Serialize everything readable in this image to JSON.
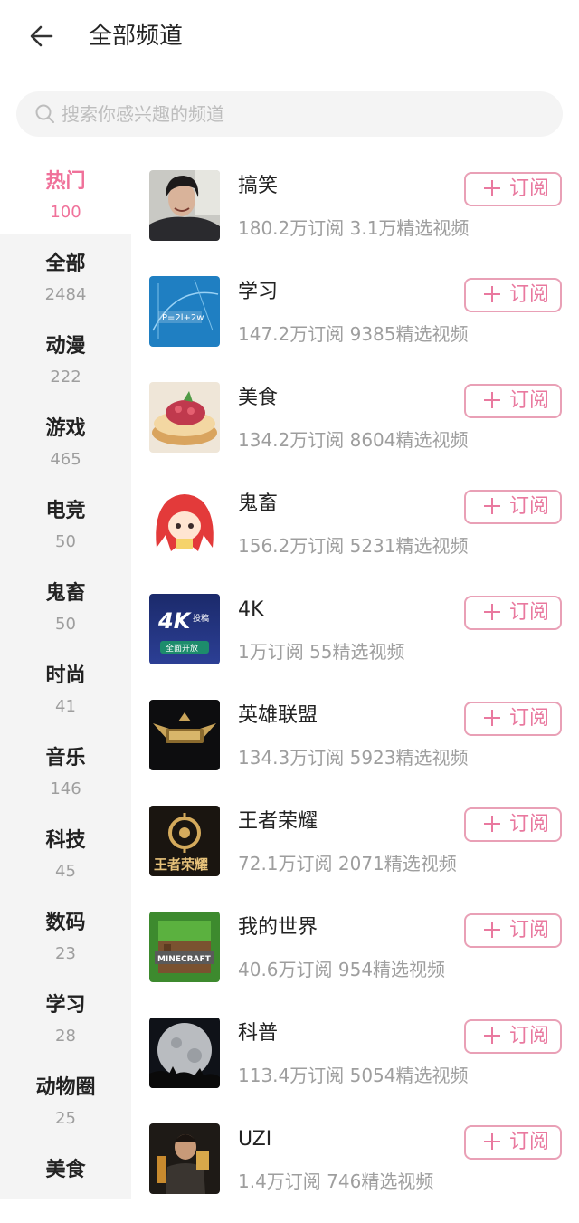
{
  "header": {
    "title": "全部频道"
  },
  "search": {
    "placeholder": "搜索你感兴趣的频道"
  },
  "colors": {
    "accent": "#f0719a",
    "subscribe_border": "#e9a0b6"
  },
  "sidebar": {
    "items": [
      {
        "name": "热门",
        "count": "100",
        "active": true
      },
      {
        "name": "全部",
        "count": "2484"
      },
      {
        "name": "动漫",
        "count": "222"
      },
      {
        "name": "游戏",
        "count": "465"
      },
      {
        "name": "电竞",
        "count": "50"
      },
      {
        "name": "鬼畜",
        "count": "50"
      },
      {
        "name": "时尚",
        "count": "41"
      },
      {
        "name": "音乐",
        "count": "146"
      },
      {
        "name": "科技",
        "count": "45"
      },
      {
        "name": "数码",
        "count": "23"
      },
      {
        "name": "学习",
        "count": "28"
      },
      {
        "name": "动物圈",
        "count": "25"
      },
      {
        "name": "美食",
        "count": ""
      }
    ]
  },
  "channels": [
    {
      "name": "搞笑",
      "stats": "180.2万订阅  3.1万精选视频",
      "subscribe": "订阅",
      "thumb_icon": "person-photo"
    },
    {
      "name": "学习",
      "stats": "147.2万订阅  9385精选视频",
      "subscribe": "订阅",
      "thumb_icon": "math-board",
      "thumb_text": "P=2l+2w"
    },
    {
      "name": "美食",
      "stats": "134.2万订阅  8604精选视频",
      "subscribe": "订阅",
      "thumb_icon": "pancake-photo"
    },
    {
      "name": "鬼畜",
      "stats": "156.2万订阅  5231精选视频",
      "subscribe": "订阅",
      "thumb_icon": "anime-mascot"
    },
    {
      "name": "4K",
      "stats": "1万订阅  55精选视频",
      "subscribe": "订阅",
      "thumb_icon": "4k-logo",
      "thumb_text": "4K",
      "thumb_text2": "投稿",
      "thumb_text3": "全面开放"
    },
    {
      "name": "英雄联盟",
      "stats": "134.3万订阅  5923精选视频",
      "subscribe": "订阅",
      "thumb_icon": "lol-logo"
    },
    {
      "name": "王者荣耀",
      "stats": "72.1万订阅  2071精选视频",
      "subscribe": "订阅",
      "thumb_icon": "hok-logo",
      "thumb_text": "王者荣耀"
    },
    {
      "name": "我的世界",
      "stats": "40.6万订阅  954精选视频",
      "subscribe": "订阅",
      "thumb_icon": "minecraft-logo",
      "thumb_text": "MINECRAFT"
    },
    {
      "name": "科普",
      "stats": "113.4万订阅  5054精选视频",
      "subscribe": "订阅",
      "thumb_icon": "moon-photo"
    },
    {
      "name": "UZI",
      "stats": "1.4万订阅  746精选视频",
      "subscribe": "订阅",
      "thumb_icon": "player-photo"
    }
  ]
}
